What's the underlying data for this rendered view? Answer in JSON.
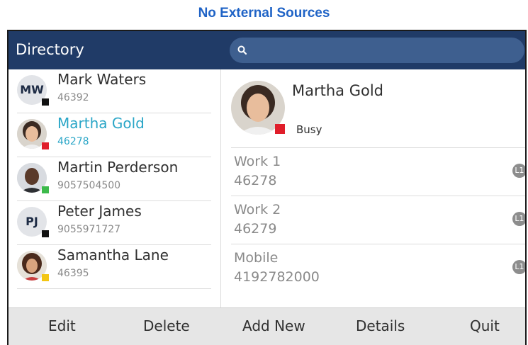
{
  "caption": "No External Sources",
  "header": {
    "title": "Directory",
    "search_icon": "search-icon"
  },
  "contacts": [
    {
      "name": "Mark Waters",
      "number": "46392",
      "initials": "MW",
      "status_color": "#111111",
      "selected": false
    },
    {
      "name": "Martha Gold",
      "number": "46278",
      "initials": "",
      "status_color": "#e01e2a",
      "selected": true
    },
    {
      "name": "Martin Perderson",
      "number": "9057504500",
      "initials": "",
      "status_color": "#3cba4b",
      "selected": false
    },
    {
      "name": "Peter James",
      "number": "9055971727",
      "initials": "PJ",
      "status_color": "#111111",
      "selected": false
    },
    {
      "name": "Samantha Lane",
      "number": "46395",
      "initials": "",
      "status_color": "#f3c614",
      "selected": false
    }
  ],
  "detail": {
    "name": "Martha Gold",
    "presence": "Busy",
    "presence_color": "#e01e2a",
    "numbers": [
      {
        "label": "Work 1",
        "number": "46278",
        "line": "L1"
      },
      {
        "label": "Work 2",
        "number": "46279",
        "line": "L1"
      },
      {
        "label": "Mobile",
        "number": "4192782000",
        "line": "L1"
      }
    ]
  },
  "softkeys": {
    "edit": "Edit",
    "delete": "Delete",
    "add_new": "Add New",
    "details": "Details",
    "quit": "Quit"
  },
  "colors": {
    "header": "#203b67",
    "search": "#3e5f8f",
    "selected_text": "#2aa6c7",
    "caption": "#1f63c6"
  }
}
